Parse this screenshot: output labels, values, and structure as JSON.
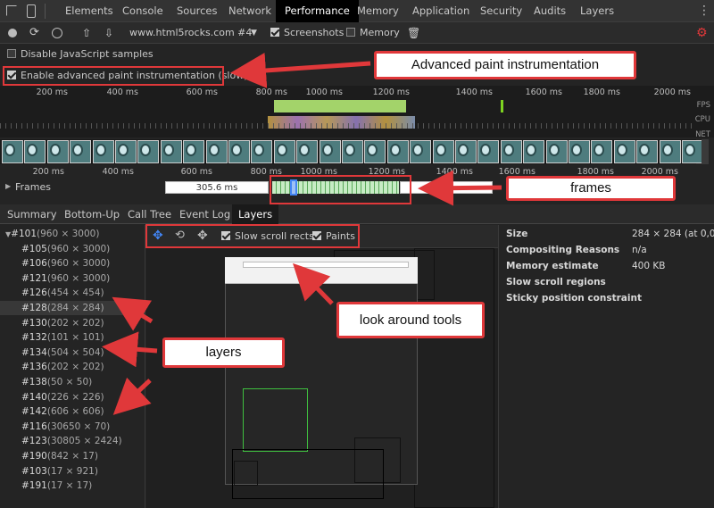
{
  "tabs": [
    "Elements",
    "Console",
    "Sources",
    "Network",
    "Performance",
    "Memory",
    "Application",
    "Security",
    "Audits",
    "Layers"
  ],
  "toolbar": {
    "profile_url": "www.html5rocks.com #4",
    "screenshots_label": "Screenshots",
    "memory_label": "Memory"
  },
  "options": {
    "disable_js_label": "Disable JavaScript samples",
    "advanced_paint_label": "Enable advanced paint instrumentation (slow)"
  },
  "overview": {
    "ruler_ticks": [
      "200 ms",
      "400 ms",
      "600 ms",
      "800 ms",
      "1000 ms",
      "1200 ms",
      "1400 ms",
      "1600 ms",
      "1800 ms",
      "2000 ms"
    ],
    "lanes": [
      "FPS",
      "CPU",
      "NET"
    ],
    "ruler2_ticks": [
      "200 ms",
      "400 ms",
      "600 ms",
      "800 ms",
      "1000 ms",
      "1200 ms",
      "1400 ms",
      "1600 ms",
      "1800 ms",
      "2000 ms"
    ]
  },
  "frames": {
    "label": "Frames",
    "first_duration": "305.6 ms"
  },
  "panel_tabs": [
    "Summary",
    "Bottom-Up",
    "Call Tree",
    "Event Log",
    "Layers"
  ],
  "layers": [
    {
      "id": "#101",
      "size": "(960 × 3000)"
    },
    {
      "id": "#105",
      "size": "(960 × 3000)"
    },
    {
      "id": "#106",
      "size": "(960 × 3000)"
    },
    {
      "id": "#121",
      "size": "(960 × 3000)"
    },
    {
      "id": "#126",
      "size": "(454 × 454)"
    },
    {
      "id": "#128",
      "size": "(284 × 284)"
    },
    {
      "id": "#130",
      "size": "(202 × 202)"
    },
    {
      "id": "#132",
      "size": "(101 × 101)"
    },
    {
      "id": "#134",
      "size": "(504 × 504)"
    },
    {
      "id": "#136",
      "size": "(202 × 202)"
    },
    {
      "id": "#138",
      "size": "(50 × 50)"
    },
    {
      "id": "#140",
      "size": "(226 × 226)"
    },
    {
      "id": "#142",
      "size": "(606 × 606)"
    },
    {
      "id": "#116",
      "size": "(30650 × 70)"
    },
    {
      "id": "#123",
      "size": "(30805 × 2424)"
    },
    {
      "id": "#190",
      "size": "(842 × 17)"
    },
    {
      "id": "#103",
      "size": "(17 × 921)"
    },
    {
      "id": "#191",
      "size": "(17 × 17)"
    }
  ],
  "viewer": {
    "slow_scroll_label": "Slow scroll rects",
    "paints_label": "Paints"
  },
  "details": [
    {
      "key": "Size",
      "value": "284 × 284 (at 0,0)"
    },
    {
      "key": "Compositing Reasons",
      "value": "n/a"
    },
    {
      "key": "Memory estimate",
      "value": "400 KB"
    },
    {
      "key": "Slow scroll regions",
      "value": ""
    },
    {
      "key": "Sticky position constraint",
      "value": ""
    }
  ],
  "annotations": {
    "advanced_paint": "Advanced paint instrumentation",
    "frames": "frames",
    "look_around": "look around tools",
    "layers": "layers"
  },
  "colors": {
    "accent": "#4285f4",
    "annotation_red": "#e0383a",
    "fps_green": "#7ed321"
  }
}
